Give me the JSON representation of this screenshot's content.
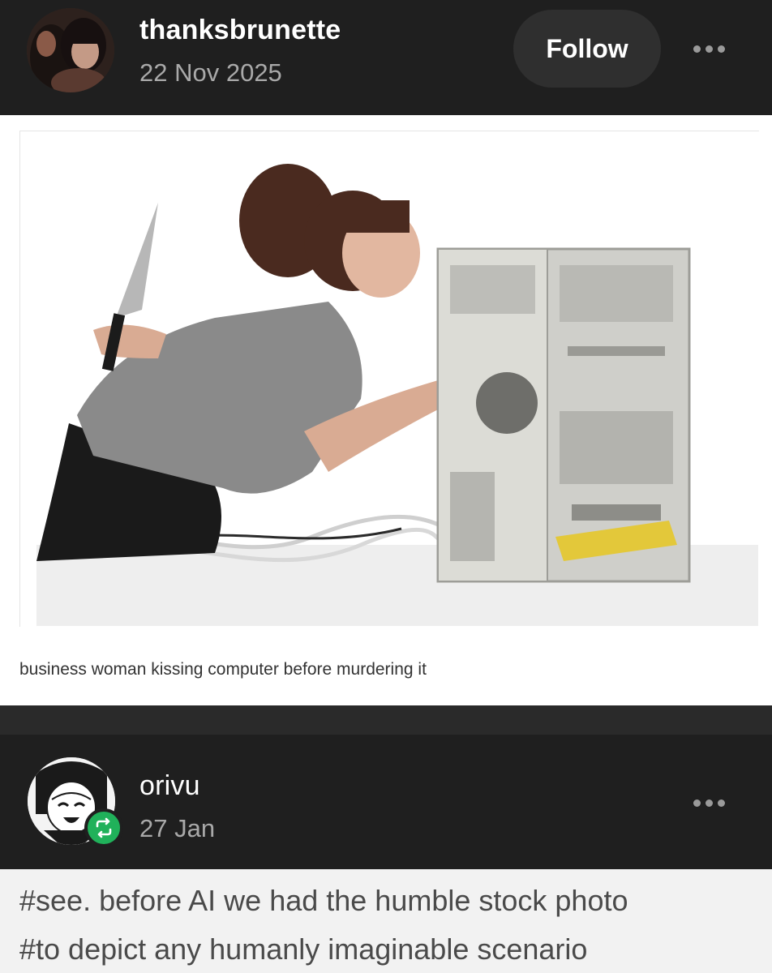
{
  "post": {
    "username": "thanksbrunette",
    "date": "22 Nov 2025",
    "follow_label": "Follow",
    "more_icon": "more-horizontal-icon",
    "image_caption": "business woman kissing computer before murdering it"
  },
  "reblog": {
    "username": "orivu",
    "date": "27 Jan",
    "badge_icon": "reblog-icon",
    "more_icon": "more-horizontal-icon",
    "badge_color": "#20b15a"
  },
  "tags": [
    "#see. before AI we had the humble stock photo",
    "#to depict any humanly imaginable scenario"
  ],
  "colors": {
    "header_bg": "#1f1f1f",
    "tags_bg": "#f2f2f2"
  }
}
